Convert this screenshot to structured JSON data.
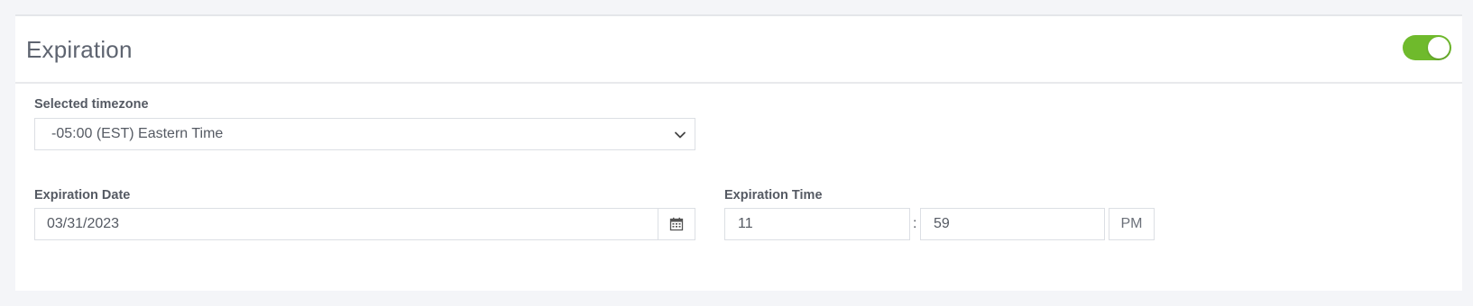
{
  "section": {
    "title": "Expiration",
    "enabled": true
  },
  "timezone": {
    "label": "Selected timezone",
    "value": "-05:00 (EST) Eastern Time"
  },
  "date": {
    "label": "Expiration Date",
    "value": "03/31/2023",
    "icon": "calendar-icon"
  },
  "time": {
    "label": "Expiration Time",
    "hour": "11",
    "separator": ":",
    "minute": "59",
    "period": "PM"
  },
  "colors": {
    "toggle_on": "#6fba2c",
    "page_bg": "#f4f5f8"
  }
}
